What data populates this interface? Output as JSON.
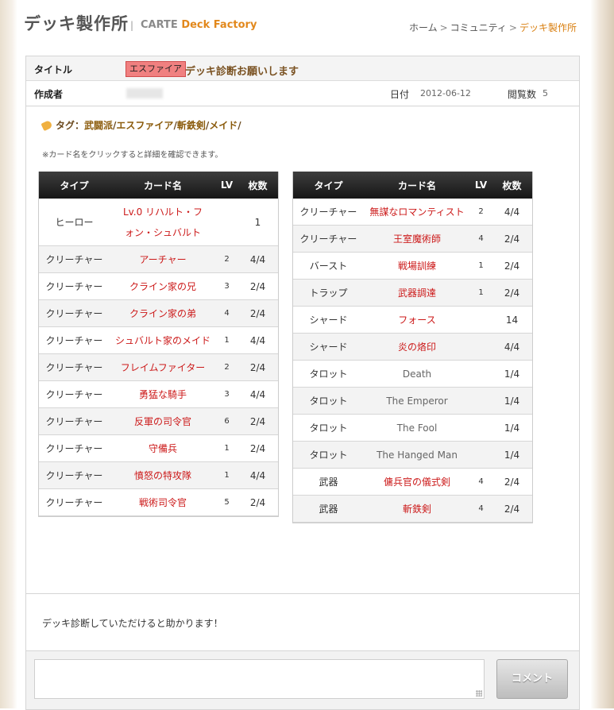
{
  "header": {
    "site_title": "デッキ製作所",
    "separator": "|",
    "brand_left": "CARTE",
    "brand_right": "Deck Factory",
    "breadcrumb": [
      "ホーム",
      "コミュニティ",
      "デッキ製作所"
    ]
  },
  "info": {
    "title_label": "タイトル",
    "badge": "エスファイア",
    "title": "デッキ診断お願いします",
    "author_label": "作成者",
    "date_label": "日付",
    "date": "2012-06-12",
    "views_label": "閲覧数",
    "views": "5"
  },
  "tags": {
    "prefix": "タグ：",
    "items": [
      "武闘派",
      "エスファイア",
      "斬鉄剣",
      "メイド"
    ]
  },
  "note": "※カード名をクリックすると詳細を確認できます。",
  "table_headers": [
    "タイプ",
    "カード名",
    "LV",
    "枚数"
  ],
  "deck_left": [
    {
      "type": "ヒーロー",
      "name": "Lv.0 リハルト・フォン・シュバルト",
      "lv": "",
      "count": "1"
    },
    {
      "type": "クリーチャー",
      "name": "アーチャー",
      "lv": "2",
      "count": "4/4"
    },
    {
      "type": "クリーチャー",
      "name": "クライン家の兄",
      "lv": "3",
      "count": "2/4"
    },
    {
      "type": "クリーチャー",
      "name": "クライン家の弟",
      "lv": "4",
      "count": "2/4"
    },
    {
      "type": "クリーチャー",
      "name": "シュバルト家のメイド",
      "lv": "1",
      "count": "4/4"
    },
    {
      "type": "クリーチャー",
      "name": "フレイムファイター",
      "lv": "2",
      "count": "2/4"
    },
    {
      "type": "クリーチャー",
      "name": "勇猛な騎手",
      "lv": "3",
      "count": "4/4"
    },
    {
      "type": "クリーチャー",
      "name": "反軍の司令官",
      "lv": "6",
      "count": "2/4"
    },
    {
      "type": "クリーチャー",
      "name": "守備兵",
      "lv": "1",
      "count": "2/4"
    },
    {
      "type": "クリーチャー",
      "name": "憤怒の特攻隊",
      "lv": "1",
      "count": "4/4"
    },
    {
      "type": "クリーチャー",
      "name": "戦術司令官",
      "lv": "5",
      "count": "2/4"
    }
  ],
  "deck_right": [
    {
      "type": "クリーチャー",
      "name": "無謀なロマンティスト",
      "lv": "2",
      "count": "4/4"
    },
    {
      "type": "クリーチャー",
      "name": "王室魔術師",
      "lv": "4",
      "count": "2/4"
    },
    {
      "type": "バースト",
      "name": "戦場訓練",
      "lv": "1",
      "count": "2/4"
    },
    {
      "type": "トラップ",
      "name": "武器調達",
      "lv": "1",
      "count": "2/4"
    },
    {
      "type": "シャード",
      "name": "フォース",
      "lv": "",
      "count": "14"
    },
    {
      "type": "シャード",
      "name": "炎の烙印",
      "lv": "",
      "count": "4/4"
    },
    {
      "type": "タロット",
      "name": "Death",
      "lv": "",
      "count": "1/4",
      "gray": true
    },
    {
      "type": "タロット",
      "name": "The Emperor",
      "lv": "",
      "count": "1/4",
      "gray": true
    },
    {
      "type": "タロット",
      "name": "The Fool",
      "lv": "",
      "count": "1/4",
      "gray": true
    },
    {
      "type": "タロット",
      "name": "The Hanged Man",
      "lv": "",
      "count": "1/4",
      "gray": true
    },
    {
      "type": "武器",
      "name": "傭兵官の儀式剣",
      "lv": "4",
      "count": "2/4"
    },
    {
      "type": "武器",
      "name": "斬鉄剣",
      "lv": "4",
      "count": "2/4"
    }
  ],
  "message": "デッキ診断していただけると助かります！",
  "comment": {
    "input_value": "",
    "button_label": "コメント"
  }
}
